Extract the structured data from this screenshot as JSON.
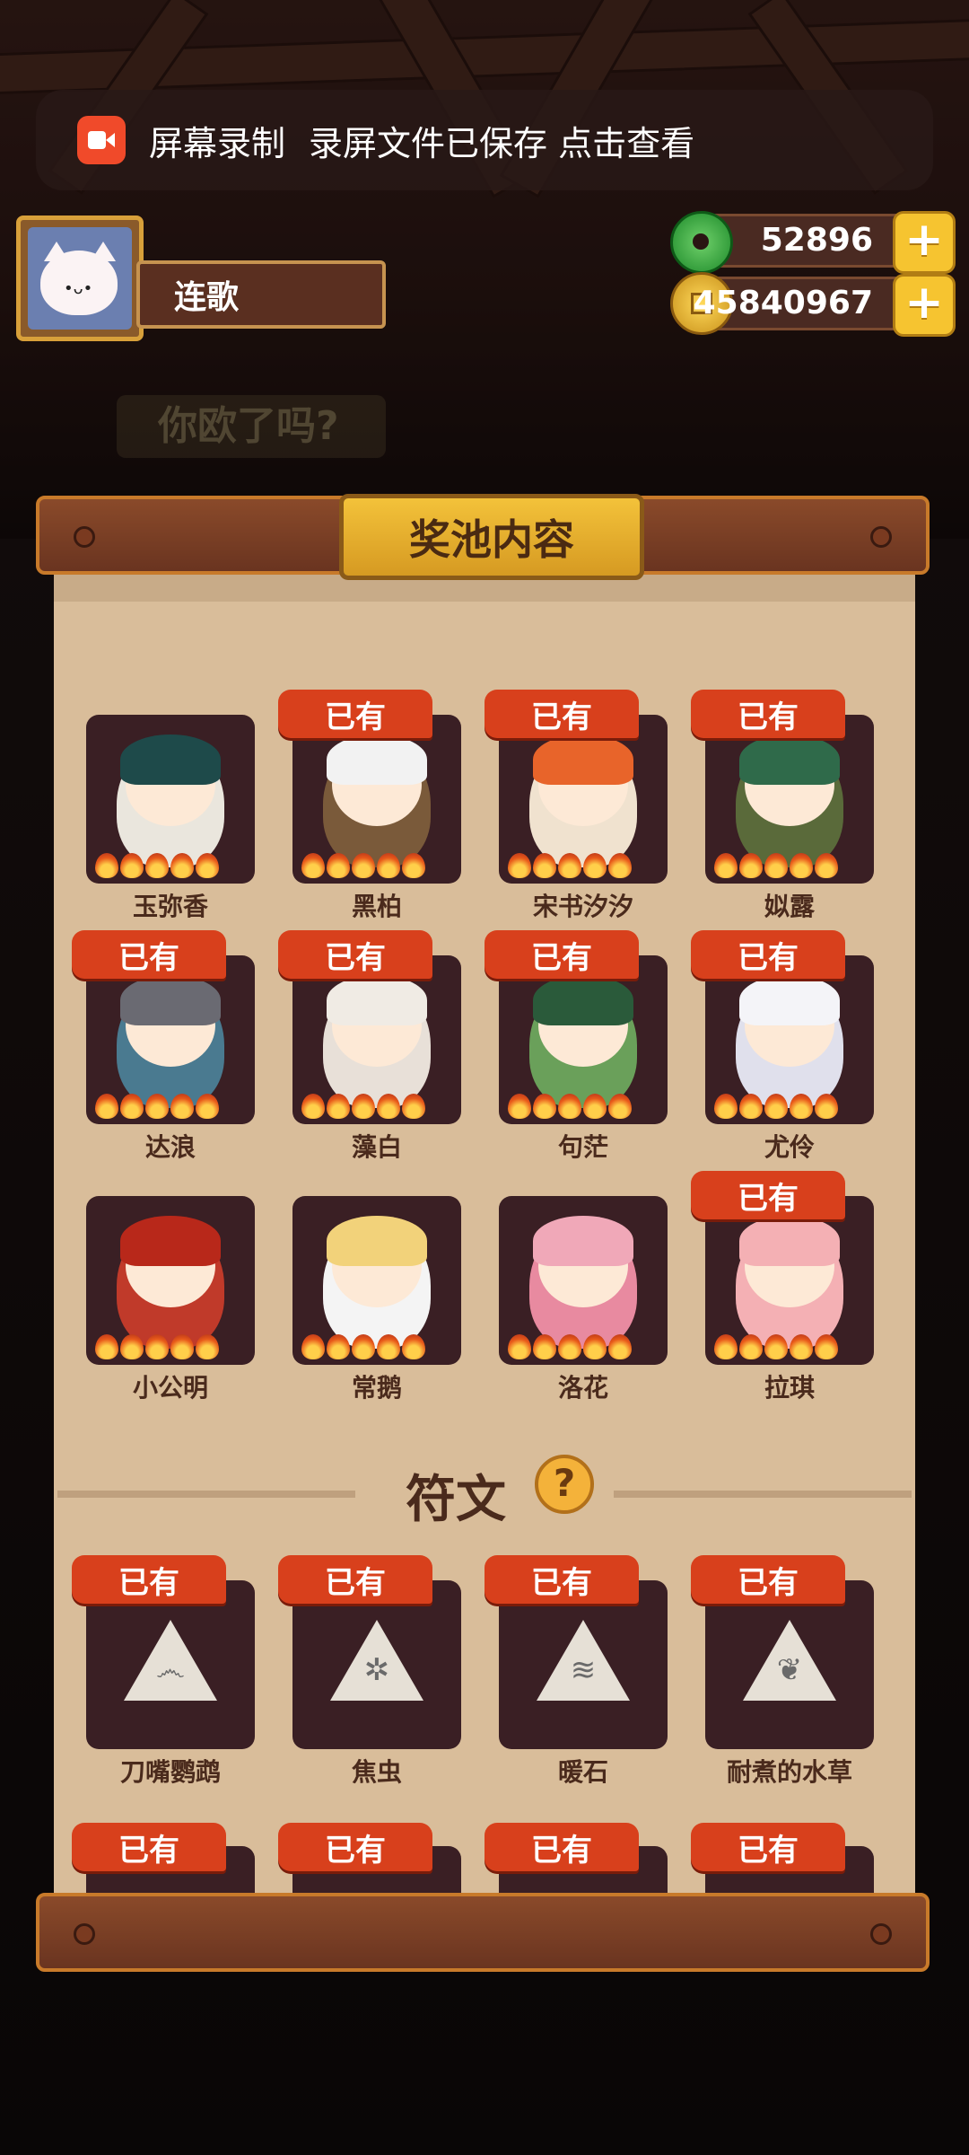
{
  "toast": {
    "app": "屏幕录制",
    "message": "录屏文件已保存 点击查看"
  },
  "player": {
    "name": "连歌"
  },
  "currency": {
    "jade": "52896",
    "coins": "45840967",
    "plus": "+"
  },
  "background_text": "你欧了吗?",
  "modal": {
    "title": "奖池内容",
    "owned_label": "已有"
  },
  "characters": [
    {
      "name": "玉弥香",
      "owned": false,
      "hair": "#1e4a4a",
      "body": "#eae6dd"
    },
    {
      "name": "黑柏",
      "owned": true,
      "hair": "#f2f2f2",
      "body": "#7a5a3a"
    },
    {
      "name": "宋书汐汐",
      "owned": true,
      "hair": "#e8642a",
      "body": "#f0e2cf"
    },
    {
      "name": "姒露",
      "owned": true,
      "hair": "#2f6a4a",
      "body": "#5a6a3a"
    },
    {
      "name": "达浪",
      "owned": true,
      "hair": "#6a6a72",
      "body": "#4a7a90"
    },
    {
      "name": "藻白",
      "owned": true,
      "hair": "#f0ebe4",
      "body": "#e8e0d8"
    },
    {
      "name": "句茫",
      "owned": true,
      "hair": "#2a5a3a",
      "body": "#6aa05a"
    },
    {
      "name": "尤伶",
      "owned": true,
      "hair": "#f4f4f8",
      "body": "#e0e0ec"
    },
    {
      "name": "小公明",
      "owned": false,
      "hair": "#b8281a",
      "body": "#c03a2a"
    },
    {
      "name": "常鹅",
      "owned": false,
      "hair": "#f2d27a",
      "body": "#f4f4f4"
    },
    {
      "name": "洛花",
      "owned": false,
      "hair": "#f0a8b8",
      "body": "#e88aa0"
    },
    {
      "name": "拉琪",
      "owned": true,
      "hair": "#f4b0b4",
      "body": "#f4b0b4"
    }
  ],
  "runes_section": {
    "title": "符文",
    "help": "?"
  },
  "runes": [
    {
      "name": "刀嘴鹦鹉",
      "owned": true,
      "glyph": "෴"
    },
    {
      "name": "焦虫",
      "owned": true,
      "glyph": "✲"
    },
    {
      "name": "暖石",
      "owned": true,
      "glyph": "≋"
    },
    {
      "name": "耐煮的水草",
      "owned": true,
      "glyph": "❦"
    }
  ],
  "bottom_row_badges": [
    "已有",
    "已有",
    "已有",
    "已有"
  ]
}
